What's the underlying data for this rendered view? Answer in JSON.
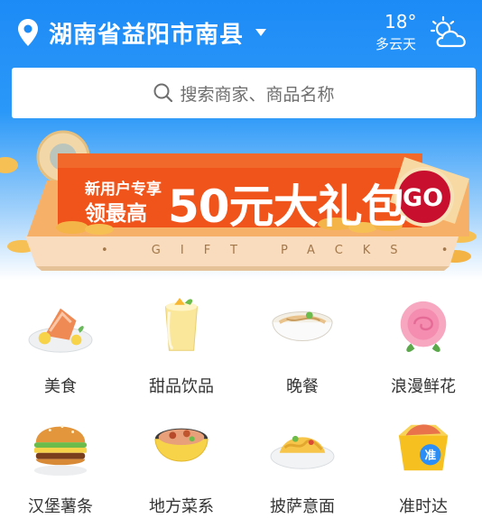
{
  "header": {
    "location": "湖南省益阳市南县",
    "location_icon": "location-pin-icon",
    "dropdown_icon": "caret-down-icon"
  },
  "weather": {
    "temperature": "18°",
    "description": "多云天",
    "icon": "partly-cloudy-icon"
  },
  "search": {
    "placeholder": "搜索商家、商品名称",
    "icon": "search-icon"
  },
  "banner": {
    "line1": "新用户专享",
    "line2": "领最高",
    "headline": "50元大礼包",
    "go": "GO",
    "subtitle": "• GIFT PACKS •"
  },
  "categories": [
    {
      "label": "美食",
      "icon": "food-dish-icon"
    },
    {
      "label": "甜品饮品",
      "icon": "dessert-drink-icon"
    },
    {
      "label": "晚餐",
      "icon": "noodle-bowl-icon"
    },
    {
      "label": "浪漫鲜花",
      "icon": "rose-flower-icon"
    },
    {
      "label": "汉堡薯条",
      "icon": "hamburger-icon"
    },
    {
      "label": "地方菜系",
      "icon": "local-dish-icon"
    },
    {
      "label": "披萨意面",
      "icon": "pasta-icon"
    },
    {
      "label": "准时达",
      "icon": "on-time-delivery-icon"
    }
  ],
  "colors": {
    "header_blue": "#1d8bf6",
    "banner_orange": "#f0541b",
    "go_red": "#c8102e"
  }
}
